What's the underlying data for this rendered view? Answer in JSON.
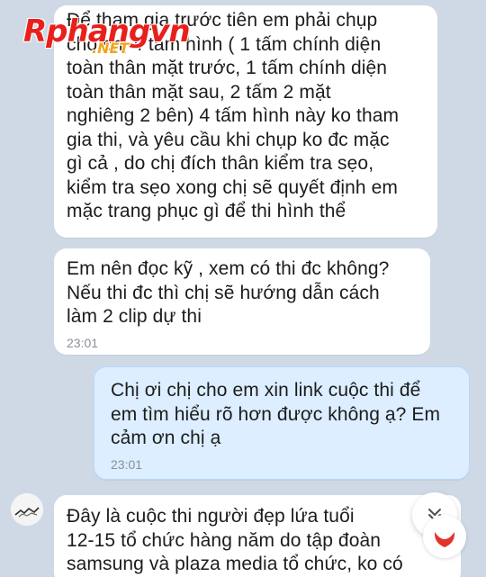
{
  "messages": [
    {
      "direction": "incoming",
      "text": "Để tham gia trước tiên em phải chụp\ncho chị 4 tấm hình ( 1 tấm chính diện\ntoàn thân mặt trước, 1 tấm chính diện\ntoàn thân mặt sau, 2 tấm 2 mặt\nnghiêng 2 bên) 4 tấm hình này ko tham\ngia thi, và yêu cầu khi chụp ko đc mặc\ngì cả , do chị đích thân kiểm tra sẹo,\nkiểm tra sẹo xong chị sẽ quyết định em\nmặc trang phục gì để thi hình thể"
    },
    {
      "direction": "incoming",
      "text": "Em nên đọc kỹ , xem có thi đc không?\nNếu thi đc thì chị sẽ hướng dẫn cách\nlàm 2 clip dự thi",
      "time": "23:01"
    },
    {
      "direction": "outgoing",
      "text": "Chị ơi chị cho em xin link cuộc thi để\nem tìm hiểu rõ hơn được không ạ? Em\ncảm ơn chị ạ",
      "time": "23:01"
    },
    {
      "direction": "incoming",
      "text": "Đây là cuộc thi người đẹp lứa tuổi\n12-15 tổ chức hàng năm do tập đoàn\nsamsung và plaza media tổ chức, ko có"
    }
  ],
  "watermark": {
    "main": "Rphangvn",
    "sub": ".NET"
  },
  "colors": {
    "background": "#cfd9e6",
    "incoming_bubble": "#ffffff",
    "outgoing_bubble": "#dceeff",
    "watermark_red": "#e8201c",
    "reaction_red": "#e0342c"
  },
  "icons": {
    "scroll_down": "double-chevron-down-icon",
    "reaction": "red-heart-icon",
    "avatar": "avatar"
  }
}
